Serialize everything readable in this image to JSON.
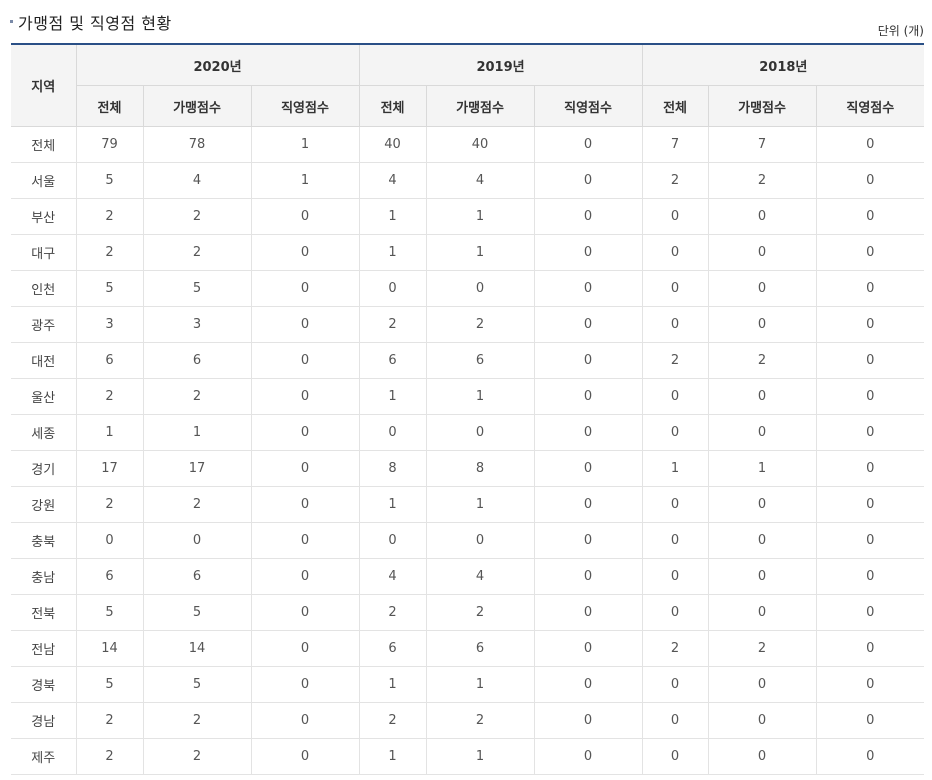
{
  "title": "가맹점 및 직영점 현황",
  "unit": "단위 (개)",
  "header": {
    "region": "지역",
    "years": [
      "2020년",
      "2019년",
      "2018년"
    ],
    "subcols": [
      "전체",
      "가맹점수",
      "직영점수"
    ]
  },
  "rows": [
    {
      "region": "전체",
      "values": [
        "79",
        "78",
        "1",
        "40",
        "40",
        "0",
        "7",
        "7",
        "0"
      ]
    },
    {
      "region": "서울",
      "values": [
        "5",
        "4",
        "1",
        "4",
        "4",
        "0",
        "2",
        "2",
        "0"
      ]
    },
    {
      "region": "부산",
      "values": [
        "2",
        "2",
        "0",
        "1",
        "1",
        "0",
        "0",
        "0",
        "0"
      ]
    },
    {
      "region": "대구",
      "values": [
        "2",
        "2",
        "0",
        "1",
        "1",
        "0",
        "0",
        "0",
        "0"
      ]
    },
    {
      "region": "인천",
      "values": [
        "5",
        "5",
        "0",
        "0",
        "0",
        "0",
        "0",
        "0",
        "0"
      ]
    },
    {
      "region": "광주",
      "values": [
        "3",
        "3",
        "0",
        "2",
        "2",
        "0",
        "0",
        "0",
        "0"
      ]
    },
    {
      "region": "대전",
      "values": [
        "6",
        "6",
        "0",
        "6",
        "6",
        "0",
        "2",
        "2",
        "0"
      ]
    },
    {
      "region": "울산",
      "values": [
        "2",
        "2",
        "0",
        "1",
        "1",
        "0",
        "0",
        "0",
        "0"
      ]
    },
    {
      "region": "세종",
      "values": [
        "1",
        "1",
        "0",
        "0",
        "0",
        "0",
        "0",
        "0",
        "0"
      ]
    },
    {
      "region": "경기",
      "values": [
        "17",
        "17",
        "0",
        "8",
        "8",
        "0",
        "1",
        "1",
        "0"
      ]
    },
    {
      "region": "강원",
      "values": [
        "2",
        "2",
        "0",
        "1",
        "1",
        "0",
        "0",
        "0",
        "0"
      ]
    },
    {
      "region": "충북",
      "values": [
        "0",
        "0",
        "0",
        "0",
        "0",
        "0",
        "0",
        "0",
        "0"
      ]
    },
    {
      "region": "충남",
      "values": [
        "6",
        "6",
        "0",
        "4",
        "4",
        "0",
        "0",
        "0",
        "0"
      ]
    },
    {
      "region": "전북",
      "values": [
        "5",
        "5",
        "0",
        "2",
        "2",
        "0",
        "0",
        "0",
        "0"
      ]
    },
    {
      "region": "전남",
      "values": [
        "14",
        "14",
        "0",
        "6",
        "6",
        "0",
        "2",
        "2",
        "0"
      ]
    },
    {
      "region": "경북",
      "values": [
        "5",
        "5",
        "0",
        "1",
        "1",
        "0",
        "0",
        "0",
        "0"
      ]
    },
    {
      "region": "경남",
      "values": [
        "2",
        "2",
        "0",
        "2",
        "2",
        "0",
        "0",
        "0",
        "0"
      ]
    },
    {
      "region": "제주",
      "values": [
        "2",
        "2",
        "0",
        "1",
        "1",
        "0",
        "0",
        "0",
        "0"
      ]
    }
  ]
}
